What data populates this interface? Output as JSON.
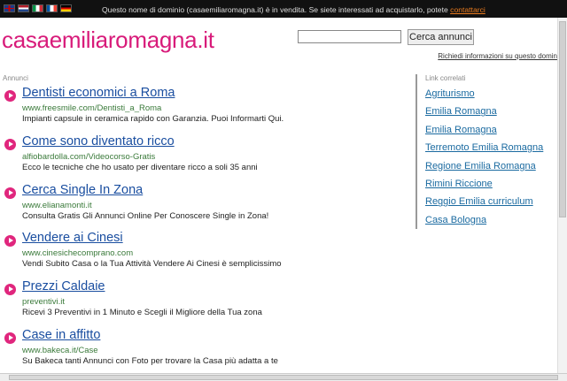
{
  "topbar": {
    "flags": [
      "uk-flag-icon",
      "netherlands-flag-icon",
      "italy-flag-icon",
      "france-flag-icon",
      "germany-flag-icon"
    ],
    "notice_text": "Questo nome di dominio (casaemiliaromagna.it) è in vendita. Se siete interessati ad acquistarlo, potete ",
    "notice_link": "contattarci"
  },
  "header": {
    "site_title": "casaemiliaromagna.it",
    "search_value": "",
    "search_button": "Cerca annunci",
    "info_link": "Richiedi informazioni su questo domin"
  },
  "ads": {
    "label": "Annunci",
    "items": [
      {
        "title": "Dentisti economici a Roma",
        "url": "www.freesmile.com/Dentisti_a_Roma",
        "desc": "Impianti capsule in ceramica rapido con Garanzia. Puoi Informarti Qui."
      },
      {
        "title": "Come sono diventato ricco",
        "url": "alfiobardolla.com/Videocorso-Gratis",
        "desc": "Ecco le tecniche che ho usato per diventare ricco a soli 35 anni"
      },
      {
        "title": "Cerca Single In Zona",
        "url": "www.elianamonti.it",
        "desc": "Consulta Gratis Gli Annunci Online Per Conoscere Single in Zona!"
      },
      {
        "title": "Vendere ai Cinesi",
        "url": "www.cinesichecomprano.com",
        "desc": "Vendi Subito Casa o la Tua Attività Vendere Ai Cinesi è semplicissimo"
      },
      {
        "title": "Prezzi Caldaie",
        "url": "preventivi.it",
        "desc": "Ricevi 3 Preventivi in 1 Minuto e Scegli il Migliore della Tua zona"
      },
      {
        "title": "Case in affitto",
        "url": "www.bakeca.it/Case",
        "desc": "Su Bakeca tanti Annunci con Foto per trovare la Casa più adatta a te"
      }
    ]
  },
  "sidebar": {
    "label": "Link correlati",
    "links": [
      "Agriturismo",
      "Emilia Romagna",
      "Emilia Romagna",
      "Terremoto Emilia Romagna",
      "Regione Emilia Romagna",
      "Rimini Riccione",
      "Reggio Emilia curriculum",
      "Casa Bologna"
    ]
  },
  "colors": {
    "brand": "#d81b7a",
    "ad_title": "#1a4ea0",
    "ad_url": "#3a7a3a",
    "side_link": "#1a6aa0",
    "notice_link": "#e87a1e"
  }
}
